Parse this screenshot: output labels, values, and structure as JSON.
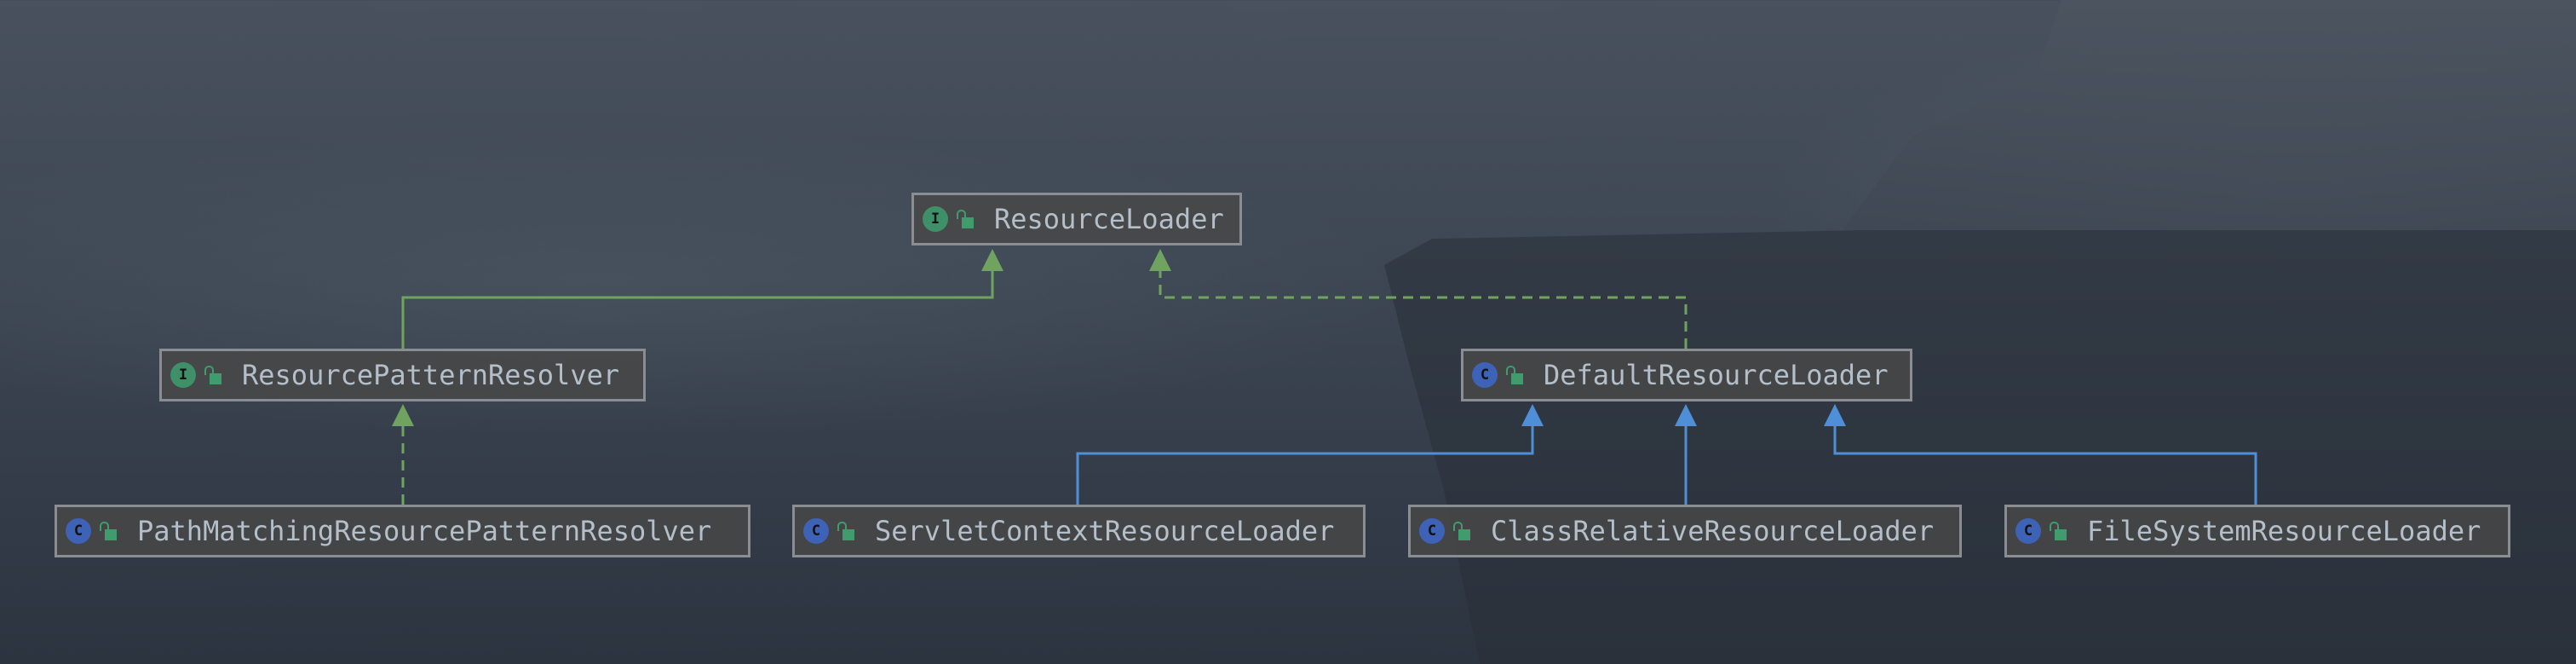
{
  "colors": {
    "implements": "#6fa35f",
    "extends": "#4f8fd8",
    "interface_badge": "#3f8f68",
    "class_badge": "#3e62b5"
  },
  "nodes": {
    "resource_loader": {
      "kind": "I",
      "name": "ResourceLoader"
    },
    "resource_pattern_resolver": {
      "kind": "I",
      "name": "ResourcePatternResolver"
    },
    "default_resource_loader": {
      "kind": "C",
      "name": "DefaultResourceLoader"
    },
    "path_matching": {
      "kind": "C",
      "name": "PathMatchingResourcePatternResolver"
    },
    "servlet_context": {
      "kind": "C",
      "name": "ServletContextResourceLoader"
    },
    "class_relative": {
      "kind": "C",
      "name": "ClassRelativeResourceLoader"
    },
    "file_system": {
      "kind": "C",
      "name": "FileSystemResourceLoader"
    }
  }
}
